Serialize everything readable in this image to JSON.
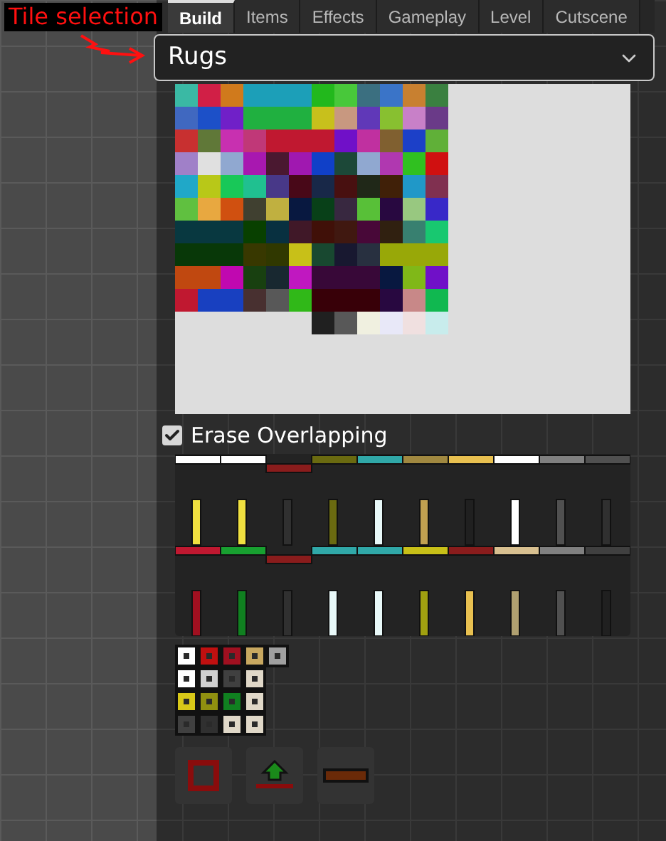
{
  "annotation": {
    "label": "Tile selection"
  },
  "tabs": [
    {
      "label": "Build",
      "selected": true
    },
    {
      "label": "Items",
      "selected": false
    },
    {
      "label": "Effects",
      "selected": false
    },
    {
      "label": "Gameplay",
      "selected": false
    },
    {
      "label": "Level",
      "selected": false
    },
    {
      "label": "Cutscene",
      "selected": false
    }
  ],
  "tile_set_dropdown": {
    "value": "Rugs"
  },
  "erase_overlapping": {
    "label": "Erase Overlapping",
    "checked": true
  }
}
